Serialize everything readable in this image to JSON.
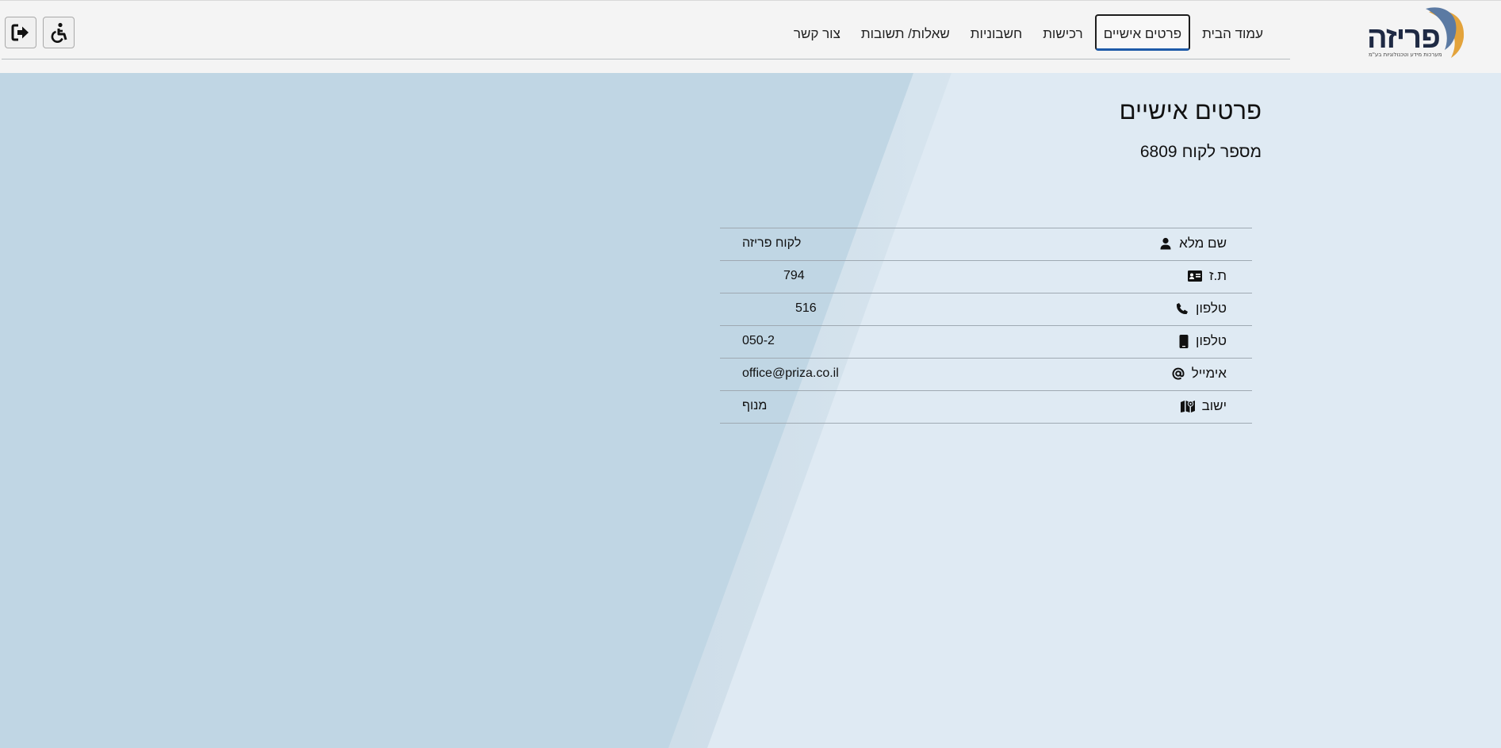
{
  "brand": {
    "name": "פריזה",
    "tagline": "מערכות מידע וטכנולוגיות בע\"מ",
    "colors": {
      "navy": "#1f2a44",
      "orange": "#e3a33b",
      "slate": "#5b7aa3"
    }
  },
  "nav": {
    "items": [
      {
        "id": "home",
        "label": "עמוד הבית",
        "active": false
      },
      {
        "id": "personal",
        "label": "פרטים אישיים",
        "active": true
      },
      {
        "id": "purchases",
        "label": "רכישות",
        "active": false
      },
      {
        "id": "invoices",
        "label": "חשבוניות",
        "active": false
      },
      {
        "id": "faq",
        "label": "שאלות/ תשובות",
        "active": false
      },
      {
        "id": "contact",
        "label": "צור קשר",
        "active": false
      }
    ]
  },
  "toolbar": {
    "accessibility_icon": "wheelchair-icon",
    "logout_icon": "sign-out-icon"
  },
  "page": {
    "title": "פרטים אישיים",
    "customer_label": "מספר לקוח",
    "customer_number": "6809"
  },
  "details": [
    {
      "icon": "user-icon",
      "label": "שם מלא",
      "value": "לקוח פריזה"
    },
    {
      "icon": "id-card-icon",
      "label": "ת.ז",
      "value": "794"
    },
    {
      "icon": "phone-icon",
      "label": "טלפון",
      "value": "516"
    },
    {
      "icon": "mobile-icon",
      "label": "טלפון",
      "value": "050-2"
    },
    {
      "icon": "at-icon",
      "label": "אימייל",
      "value": "office@priza.co.il"
    },
    {
      "icon": "map-icon",
      "label": "ישוב",
      "value": "מנוף"
    }
  ],
  "colors": {
    "background_light": "#dfeaf3",
    "background_dark": "#c0d6e4",
    "header_bg": "#f4f4f4",
    "active_underline": "#1e5aa8"
  }
}
